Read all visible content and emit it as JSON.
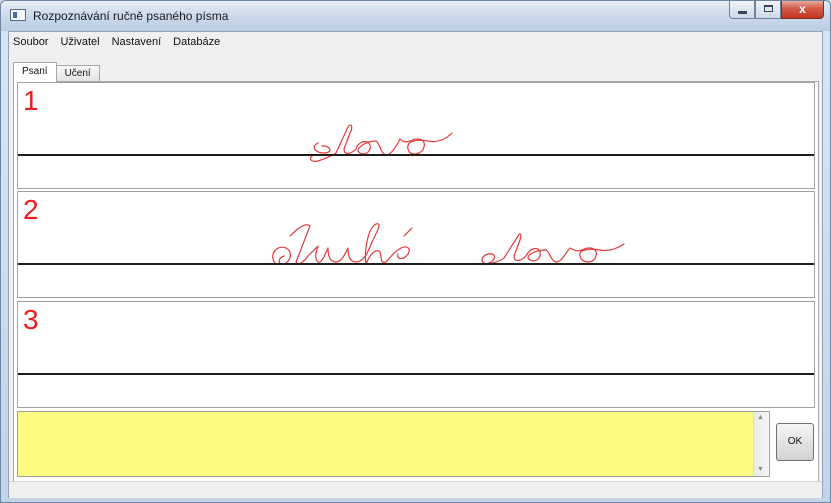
{
  "window": {
    "title": "Rozpoznávání ručně psaného písma",
    "controls": {
      "minimize": "",
      "maximize": "",
      "close": "x"
    }
  },
  "menu": [
    "Soubor",
    "Uživatel",
    "Nastavení",
    "Databáze"
  ],
  "tabs": [
    {
      "label": "Psaní",
      "active": true
    },
    {
      "label": "Učení",
      "active": false
    }
  ],
  "panels": [
    {
      "number": "1",
      "handwriting": "slovo"
    },
    {
      "number": "2",
      "handwriting": "druhé slovo"
    },
    {
      "number": "3",
      "handwriting": ""
    }
  ],
  "result": {
    "value": ""
  },
  "ok_label": "OK",
  "colors": {
    "ink": "#e23a3a",
    "panel_number": "#ef1c1c",
    "result_background": "#fffb82",
    "baseline": "#1e1e1e"
  }
}
